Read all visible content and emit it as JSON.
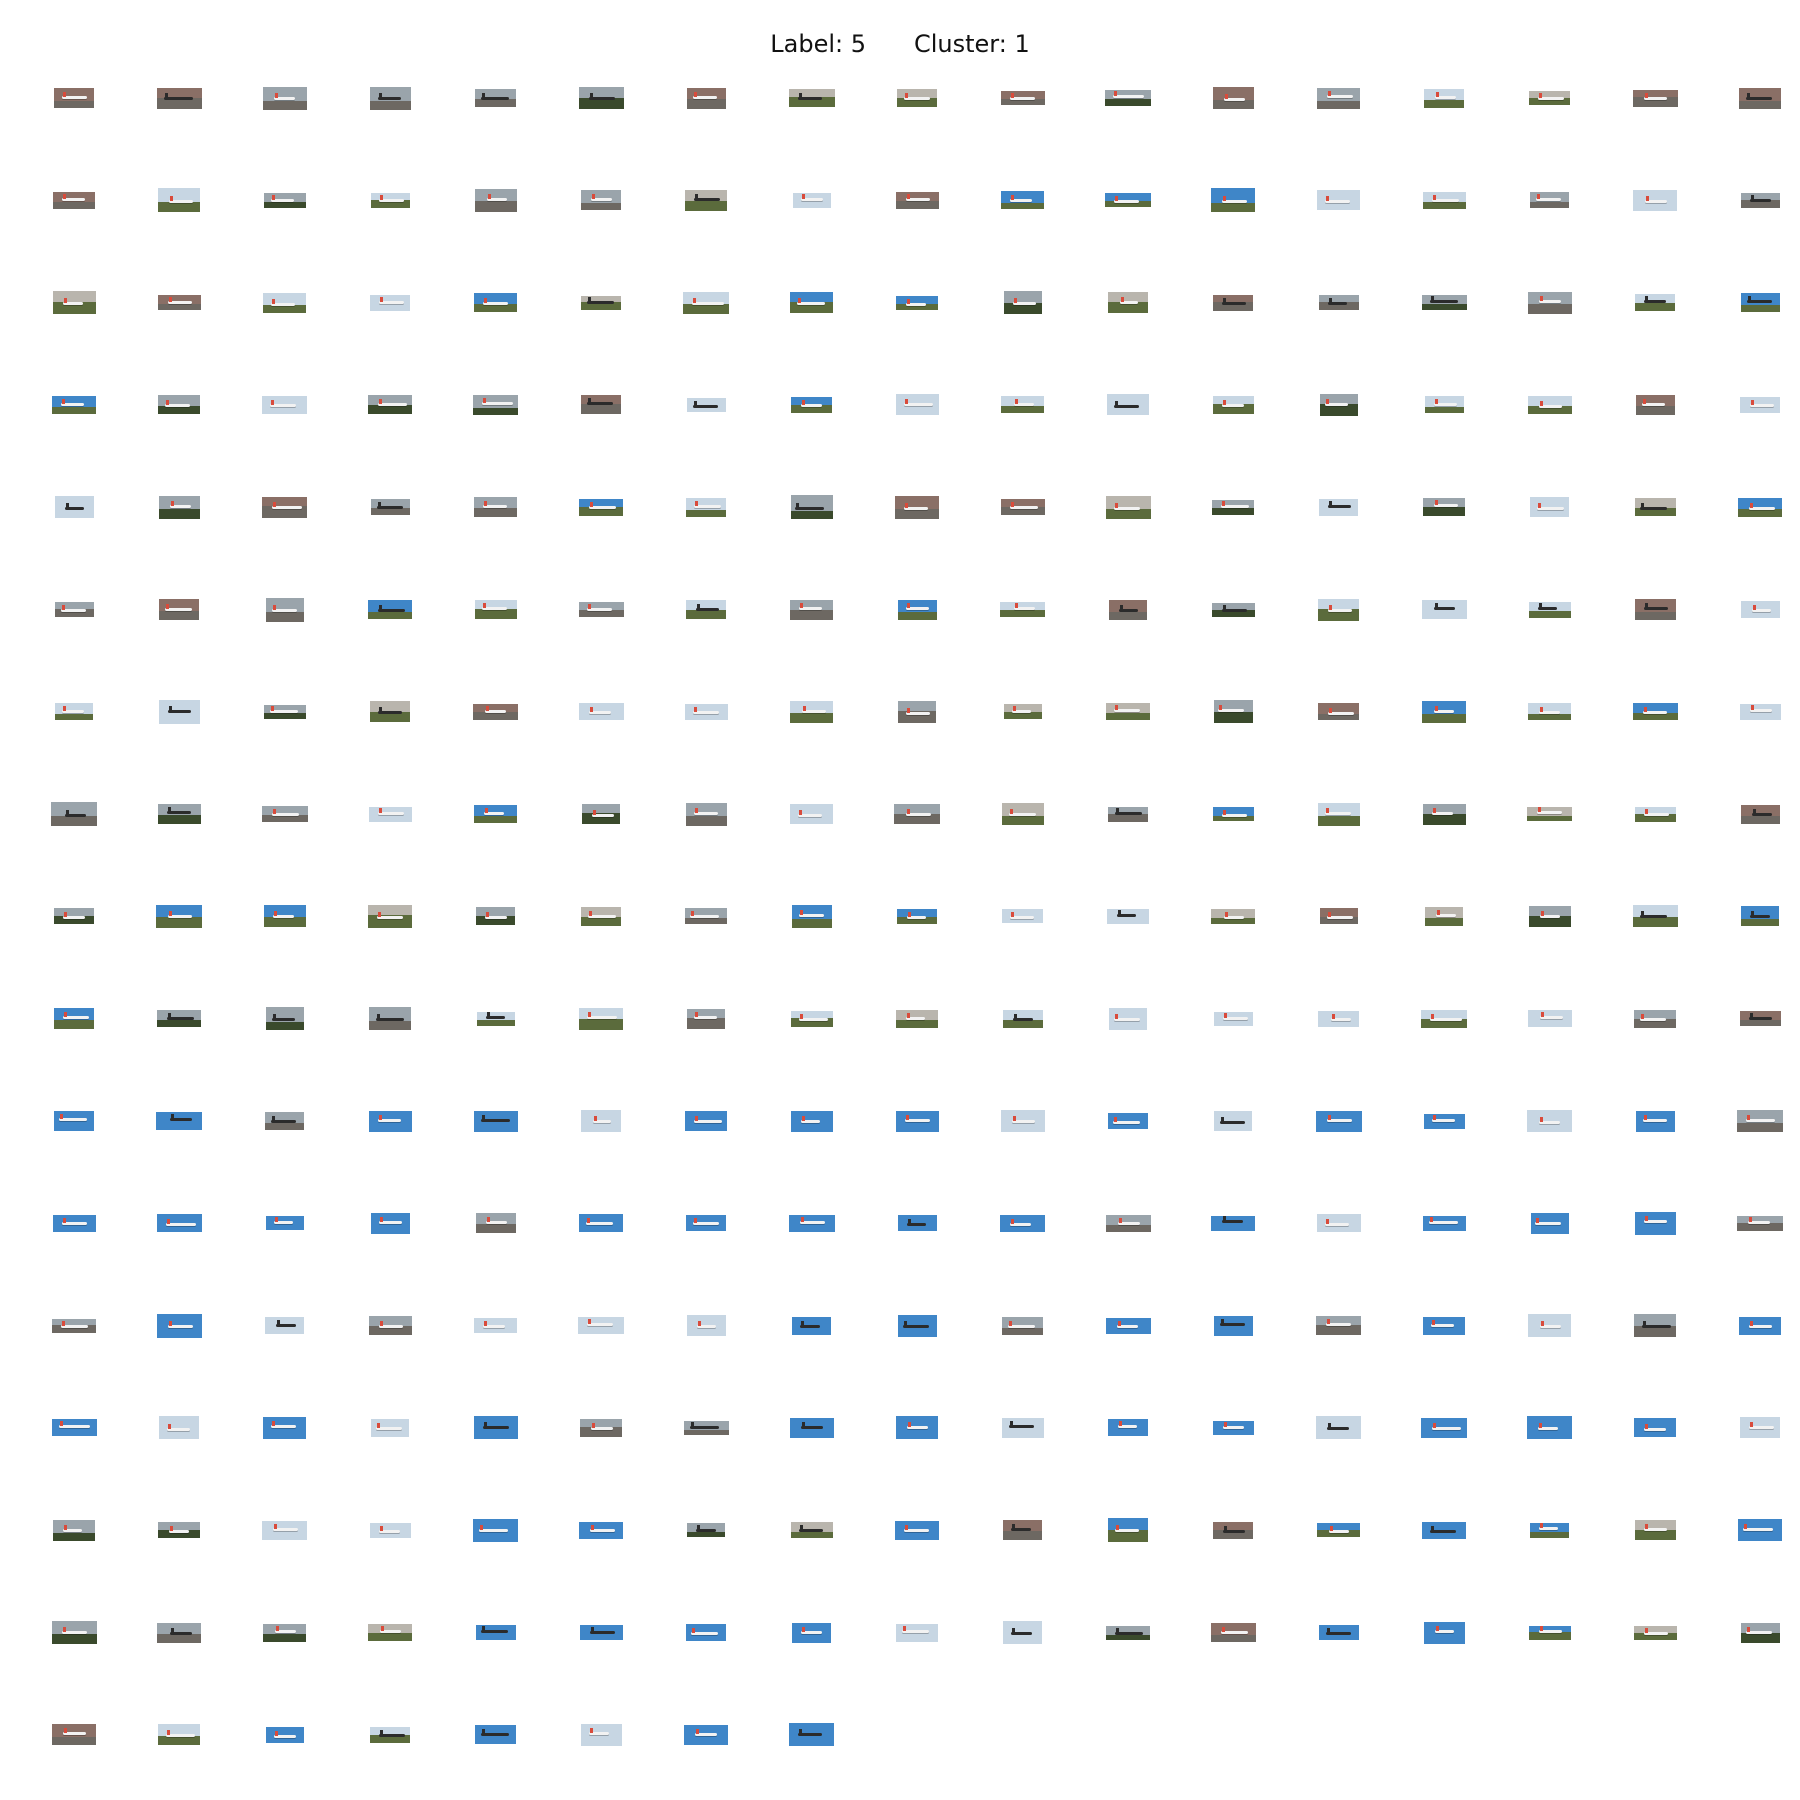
{
  "figure": {
    "label_text": "Label: 5",
    "cluster_text": "Cluster: 1"
  },
  "grid": {
    "columns": 17,
    "count": 280,
    "subject": "airplane thumbnails",
    "palette": {
      "sky_blue": "#3f86c8",
      "pale_sky": "#c7d6e3",
      "grey_sky": "#9aa4ab",
      "overcast": "#b9b5ad",
      "grass": "#5b6b3c",
      "dark_grass": "#3a4a2c",
      "tarmac": "#6d6862",
      "evening": "#8a6f66",
      "plane_white": "#f2f2f2",
      "plane_dark": "#2b2b2b"
    }
  }
}
